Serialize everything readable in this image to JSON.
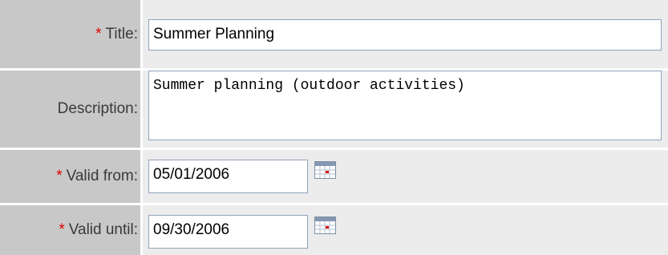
{
  "form": {
    "required_marker": "*",
    "title": {
      "label": "Title:",
      "value": "Summer Planning"
    },
    "description": {
      "label": "Description:",
      "value": "Summer planning (outdoor activities)"
    },
    "valid_from": {
      "label": "Valid from:",
      "value": "05/01/2006",
      "picker_icon": "calendar-icon"
    },
    "valid_until": {
      "label": "Valid until:",
      "value": "09/30/2006",
      "picker_icon": "calendar-icon"
    }
  },
  "colors": {
    "label_bg": "#c8c8c8",
    "field_bg": "#ececec",
    "required": "#e00000",
    "input_border": "#8fa3bd"
  }
}
